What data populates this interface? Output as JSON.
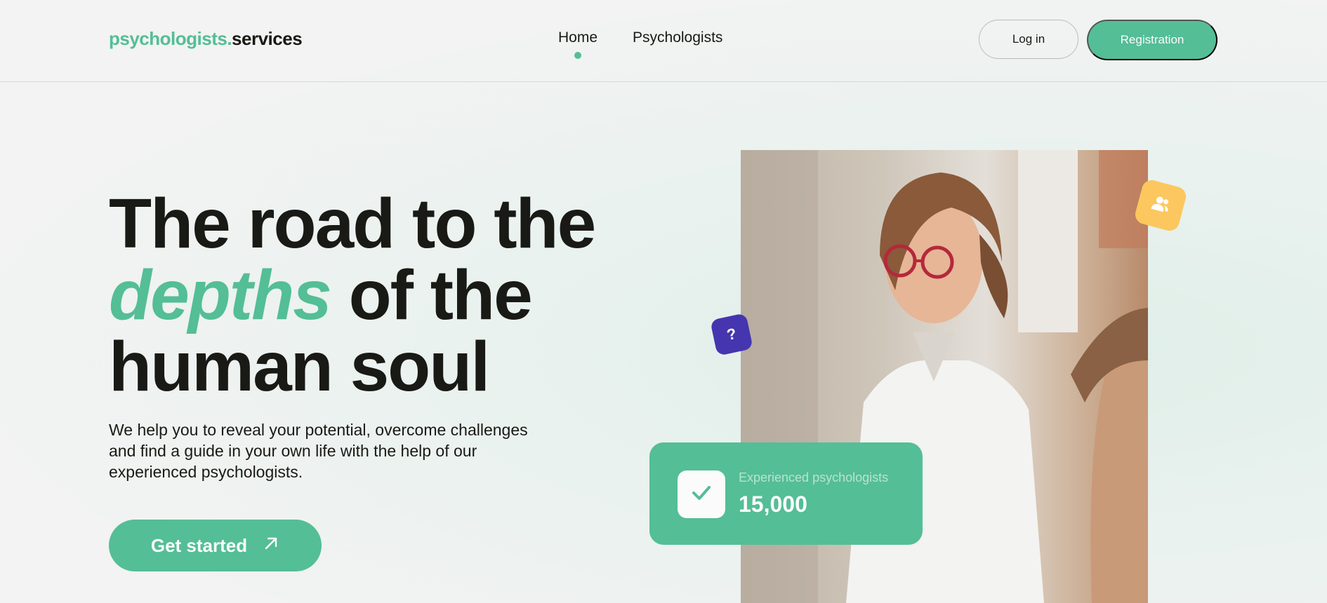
{
  "header": {
    "logo_accent": "psychologists.",
    "logo_main": "services",
    "nav": [
      {
        "label": "Home",
        "active": true
      },
      {
        "label": "Psychologists",
        "active": false
      }
    ],
    "login_label": "Log in",
    "register_label": "Registration"
  },
  "hero": {
    "title_line1": "The road to the",
    "title_accent": "depths",
    "title_line2_rest": " of the",
    "title_line3": "human soul",
    "description": "We help you to reveal your potential, overcome challenges and find a guide in your own life with the help of our experienced psychologists.",
    "cta_label": "Get started"
  },
  "stats": {
    "label": "Experienced psychologists",
    "value": "15,000"
  },
  "badges": {
    "question_symbol": "?"
  },
  "colors": {
    "accent": "#54be96",
    "text": "#191a15",
    "yellow_badge": "#fbc75e",
    "purple_badge": "#4535af"
  },
  "icons": {
    "cta": "arrow-up-right-icon",
    "people": "users-icon",
    "stat": "check-icon"
  }
}
